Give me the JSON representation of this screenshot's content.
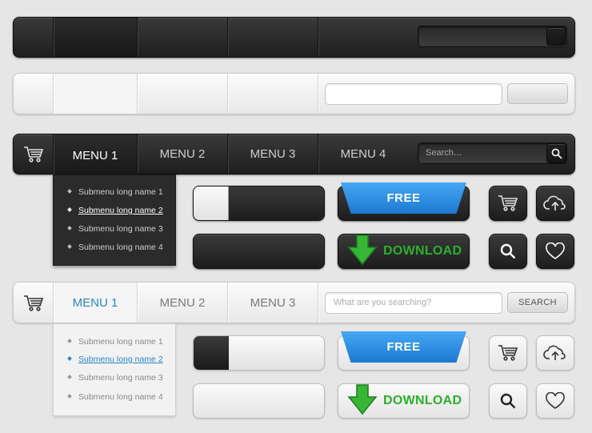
{
  "menus": {
    "dark": {
      "items": [
        "MENU 1",
        "MENU 2",
        "MENU 3",
        "MENU 4"
      ],
      "search_placeholder": "Search…"
    },
    "light": {
      "items": [
        "MENU 1",
        "MENU 2",
        "MENU 3"
      ],
      "search_placeholder": "What are you searching?",
      "search_button": "SEARCH"
    }
  },
  "submenu": [
    "Submenu long name 1",
    "Submenu long name 2",
    "Submenu long name 3",
    "Submenu long name 4"
  ],
  "buttons": {
    "free": "FREE",
    "download": "DOWNLOAD"
  },
  "colors": {
    "accent_blue": "#2a86c9",
    "ribbon_blue": "#1c78d0",
    "download_green": "#2bb12b"
  },
  "icons": [
    "cart-icon",
    "cloud-upload-icon",
    "search-icon",
    "heart-icon",
    "download-arrow-icon"
  ]
}
